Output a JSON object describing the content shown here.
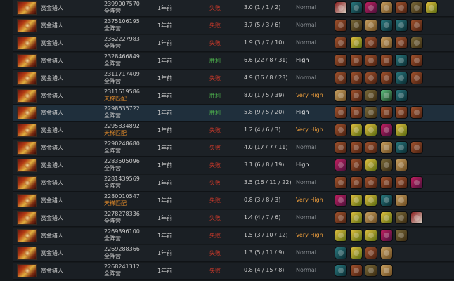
{
  "rows": [
    {
      "hero": "赏金猎人",
      "match_id": "2399007570",
      "mode": "全阵营",
      "ranked": false,
      "time": "1年前",
      "result": "失败",
      "win": false,
      "kda": "3.0 (1 / 1 / 2)",
      "skill": "Normal",
      "skill_class": "normal",
      "items": [
        "sword",
        "claw",
        "orb",
        "scroll",
        "boot",
        "glove",
        "gem"
      ]
    },
    {
      "hero": "赏金猎人",
      "match_id": "2375106195",
      "mode": "全阵营",
      "ranked": false,
      "time": "1年前",
      "result": "失败",
      "win": false,
      "kda": "3.7 (5 / 3 / 6)",
      "skill": "Normal",
      "skill_class": "normal",
      "items": [
        "boot",
        "glove",
        "scroll",
        "claw",
        "claw",
        "boot"
      ]
    },
    {
      "hero": "赏金猎人",
      "match_id": "2362227983",
      "mode": "全阵营",
      "ranked": false,
      "time": "1年前",
      "result": "失败",
      "win": false,
      "kda": "1.9 (3 / 7 / 10)",
      "skill": "Normal",
      "skill_class": "normal",
      "items": [
        "boot",
        "gem",
        "boot",
        "scroll",
        "boot",
        "glove"
      ]
    },
    {
      "hero": "赏金猎人",
      "match_id": "2328466849",
      "mode": "全阵营",
      "ranked": false,
      "time": "1年前",
      "result": "胜利",
      "win": true,
      "kda": "6.6 (22 / 8 / 31)",
      "skill": "High",
      "skill_class": "high",
      "items": [
        "boot",
        "boot",
        "boot",
        "boot",
        "claw",
        "boot"
      ]
    },
    {
      "hero": "赏金猎人",
      "match_id": "2311717409",
      "mode": "全阵营",
      "ranked": false,
      "time": "1年前",
      "result": "失败",
      "win": false,
      "kda": "4.9 (16 / 8 / 23)",
      "skill": "Normal",
      "skill_class": "normal",
      "items": [
        "boot",
        "boot",
        "boot",
        "boot",
        "claw",
        "boot"
      ]
    },
    {
      "hero": "赏金猎人",
      "match_id": "2311619586",
      "mode": "天梯匹配",
      "ranked": true,
      "time": "1年前",
      "result": "胜利",
      "win": true,
      "kda": "8.0 (1 / 5 / 39)",
      "skill": "Very High",
      "skill_class": "veryhigh",
      "items": [
        "scroll",
        "boot",
        "glove",
        "blade",
        "claw"
      ]
    },
    {
      "hero": "赏金猎人",
      "match_id": "2298635722",
      "mode": "全阵营",
      "ranked": false,
      "time": "1年前",
      "result": "胜利",
      "win": true,
      "kda": "5.8 (9 / 5 / 20)",
      "skill": "High",
      "skill_class": "high",
      "items": [
        "boot",
        "boot",
        "glove",
        "boot",
        "boot",
        "boot"
      ]
    },
    {
      "hero": "赏金猎人",
      "match_id": "2295834892",
      "mode": "天梯匹配",
      "ranked": true,
      "time": "1年前",
      "result": "失败",
      "win": false,
      "kda": "1.2 (4 / 6 / 3)",
      "skill": "Very High",
      "skill_class": "veryhigh",
      "items": [
        "boot",
        "gem",
        "gem",
        "orb",
        "gem"
      ]
    },
    {
      "hero": "赏金猎人",
      "match_id": "2290248680",
      "mode": "全阵营",
      "ranked": false,
      "time": "1年前",
      "result": "失败",
      "win": false,
      "kda": "4.0 (17 / 7 / 11)",
      "skill": "Normal",
      "skill_class": "normal",
      "items": [
        "boot",
        "boot",
        "boot",
        "scroll",
        "claw",
        "boot"
      ]
    },
    {
      "hero": "赏金猎人",
      "match_id": "2283505096",
      "mode": "全阵营",
      "ranked": false,
      "time": "1年前",
      "result": "失败",
      "win": false,
      "kda": "3.1 (6 / 8 / 19)",
      "skill": "High",
      "skill_class": "high",
      "items": [
        "orb",
        "boot",
        "gem",
        "glove",
        "scroll"
      ]
    },
    {
      "hero": "赏金猎人",
      "match_id": "2281439569",
      "mode": "全阵营",
      "ranked": false,
      "time": "1年前",
      "result": "失败",
      "win": false,
      "kda": "3.5 (16 / 11 / 22)",
      "skill": "Normal",
      "skill_class": "normal",
      "items": [
        "boot",
        "boot",
        "boot",
        "boot",
        "boot",
        "orb"
      ]
    },
    {
      "hero": "赏金猎人",
      "match_id": "2280010547",
      "mode": "天梯匹配",
      "ranked": true,
      "time": "1年前",
      "result": "失败",
      "win": false,
      "kda": "0.8 (3 / 8 / 3)",
      "skill": "Very High",
      "skill_class": "veryhigh",
      "items": [
        "orb",
        "gem",
        "gem",
        "claw",
        "scroll"
      ]
    },
    {
      "hero": "赏金猎人",
      "match_id": "2278278336",
      "mode": "全阵营",
      "ranked": false,
      "time": "1年前",
      "result": "失败",
      "win": false,
      "kda": "1.4 (4 / 7 / 6)",
      "skill": "Normal",
      "skill_class": "normal",
      "items": [
        "boot",
        "gem",
        "scroll",
        "gem",
        "glove",
        "sword"
      ]
    },
    {
      "hero": "赏金猎人",
      "match_id": "2269396100",
      "mode": "全阵营",
      "ranked": false,
      "time": "1年前",
      "result": "失败",
      "win": false,
      "kda": "1.5 (3 / 10 / 12)",
      "skill": "Very High",
      "skill_class": "veryhigh",
      "items": [
        "gem",
        "gem",
        "gem",
        "orb",
        "glove"
      ]
    },
    {
      "hero": "赏金猎人",
      "match_id": "2269288366",
      "mode": "全阵营",
      "ranked": false,
      "time": "1年前",
      "result": "失败",
      "win": false,
      "kda": "1.3 (5 / 11 / 9)",
      "skill": "Normal",
      "skill_class": "normal",
      "items": [
        "claw",
        "gem",
        "boot",
        "scroll"
      ]
    },
    {
      "hero": "赏金猎人",
      "match_id": "2268241312",
      "mode": "全阵营",
      "ranked": false,
      "time": "1年前",
      "result": "失败",
      "win": false,
      "kda": "0.8 (4 / 15 / 8)",
      "skill": "Normal",
      "skill_class": "normal",
      "items": [
        "claw",
        "boot",
        "glove",
        "scroll"
      ]
    }
  ]
}
